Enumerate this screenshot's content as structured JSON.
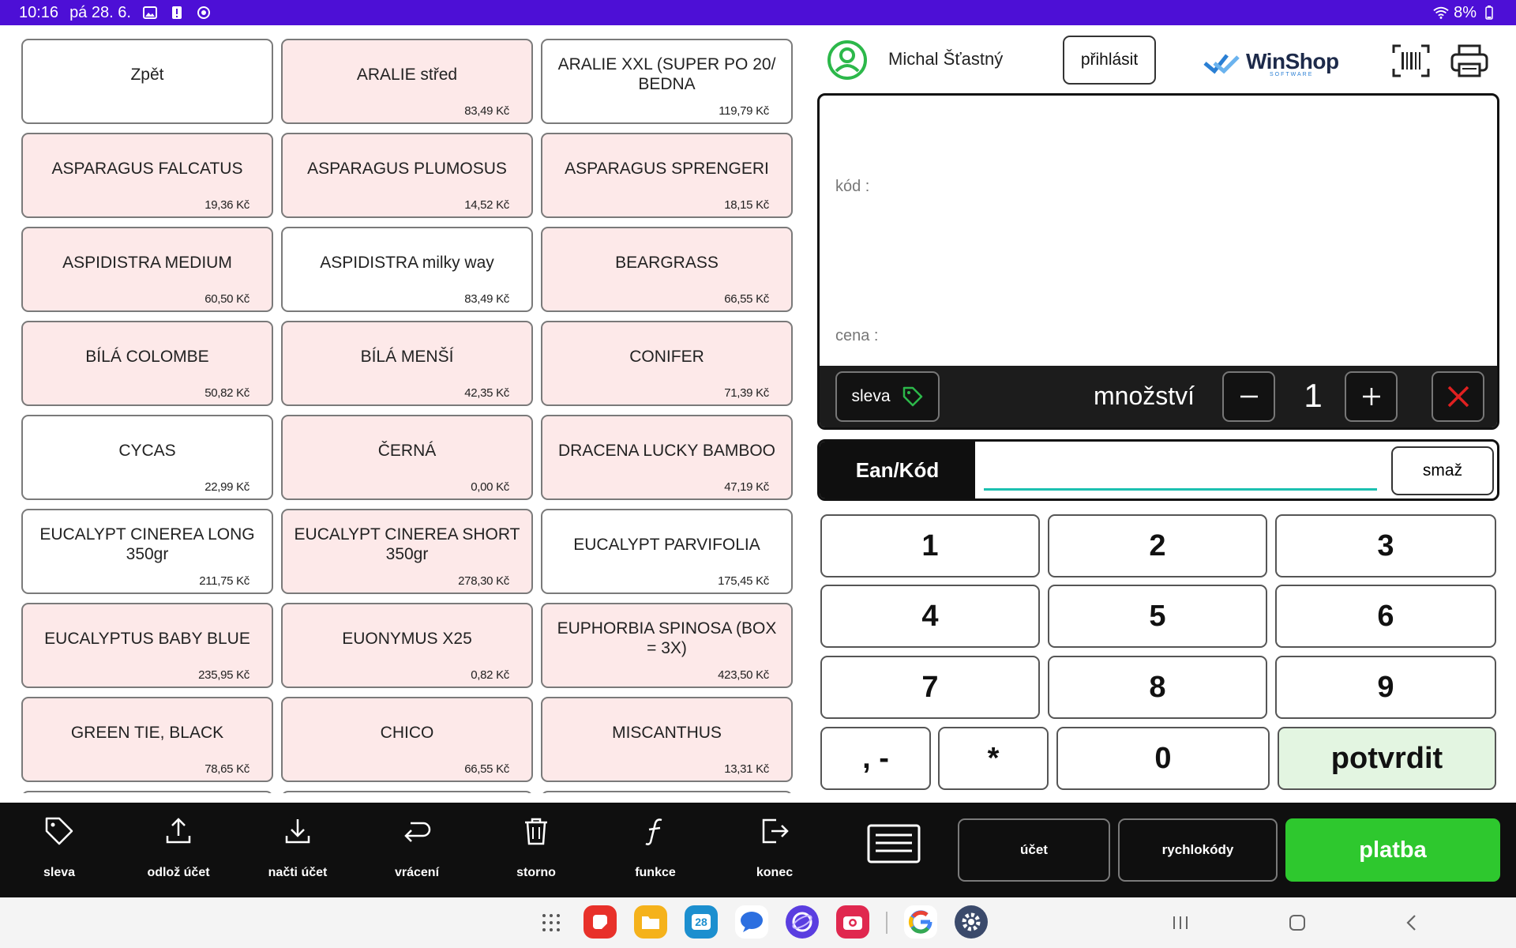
{
  "status_bar": {
    "time": "10:16",
    "date": "pá 28. 6.",
    "battery": "8%"
  },
  "products": [
    {
      "name": "Zpět",
      "price": "",
      "highlight": false
    },
    {
      "name": "ARALIE střed",
      "price": "83,49 Kč",
      "highlight": true
    },
    {
      "name": "ARALIE XXL (SUPER PO 20/ BEDNA",
      "price": "119,79 Kč",
      "highlight": false
    },
    {
      "name": "ASPARAGUS FALCATUS",
      "price": "19,36 Kč",
      "highlight": true
    },
    {
      "name": "ASPARAGUS PLUMOSUS",
      "price": "14,52 Kč",
      "highlight": true
    },
    {
      "name": "ASPARAGUS SPRENGERI",
      "price": "18,15 Kč",
      "highlight": true
    },
    {
      "name": "ASPIDISTRA MEDIUM",
      "price": "60,50 Kč",
      "highlight": true
    },
    {
      "name": "ASPIDISTRA milky way",
      "price": "83,49 Kč",
      "highlight": false
    },
    {
      "name": "BEARGRASS",
      "price": "66,55 Kč",
      "highlight": true
    },
    {
      "name": "BÍLÁ COLOMBE",
      "price": "50,82 Kč",
      "highlight": true
    },
    {
      "name": "BÍLÁ MENŠÍ",
      "price": "42,35 Kč",
      "highlight": true
    },
    {
      "name": "CONIFER",
      "price": "71,39 Kč",
      "highlight": true
    },
    {
      "name": "CYCAS",
      "price": "22,99 Kč",
      "highlight": false
    },
    {
      "name": "ČERNÁ",
      "price": "0,00 Kč",
      "highlight": true
    },
    {
      "name": "DRACENA LUCKY BAMBOO",
      "price": "47,19 Kč",
      "highlight": true
    },
    {
      "name": "EUCALYPT CINEREA LONG 350gr",
      "price": "211,75 Kč",
      "highlight": false
    },
    {
      "name": "EUCALYPT CINEREA SHORT 350gr",
      "price": "278,30 Kč",
      "highlight": true
    },
    {
      "name": "EUCALYPT PARVIFOLIA",
      "price": "175,45 Kč",
      "highlight": false
    },
    {
      "name": "EUCALYPTUS BABY BLUE",
      "price": "235,95 Kč",
      "highlight": true
    },
    {
      "name": "EUONYMUS X25",
      "price": "0,82 Kč",
      "highlight": true
    },
    {
      "name": "EUPHORBIA SPINOSA (BOX = 3X)",
      "price": "423,50 Kč",
      "highlight": true
    },
    {
      "name": "GREEN TIE, BLACK",
      "price": "78,65 Kč",
      "highlight": true
    },
    {
      "name": "CHICO",
      "price": "66,55 Kč",
      "highlight": true
    },
    {
      "name": "MISCANTHUS",
      "price": "13,31 Kč",
      "highlight": true
    }
  ],
  "header": {
    "user_name": "Michal Šťastný",
    "login_label": "přihlásit",
    "logo_text": "WinShop",
    "logo_subtext": "SOFTWARE"
  },
  "item": {
    "code_label": "kód :",
    "price_label": "cena :",
    "discount_label": "sleva",
    "quantity_label": "množství",
    "quantity_value": "1"
  },
  "ean": {
    "label": "Ean/Kód",
    "value": "",
    "clear_label": "smaž"
  },
  "keypad": {
    "keys": [
      "1",
      "2",
      "3",
      "4",
      "5",
      "6",
      "7",
      "8",
      "9"
    ],
    "comma_minus": ", -",
    "asterisk": "*",
    "zero": "0",
    "confirm": "potvrdit"
  },
  "toolbar": {
    "items": [
      {
        "label": "sleva",
        "icon": "tag-icon"
      },
      {
        "label": "odlož účet",
        "icon": "upload-icon"
      },
      {
        "label": "načti účet",
        "icon": "download-icon"
      },
      {
        "label": "vrácení",
        "icon": "return-icon"
      },
      {
        "label": "storno",
        "icon": "trash-icon"
      },
      {
        "label": "funkce",
        "icon": "function-icon"
      },
      {
        "label": "konec",
        "icon": "exit-icon"
      }
    ],
    "account_label": "účet",
    "quickcodes_label": "rychlokódy",
    "pay_label": "platba"
  },
  "nav": {
    "calendar_day": "28"
  },
  "colors": {
    "status_bar": "#4d0fd6",
    "product_highlight": "#fde9e9",
    "pay_button": "#2ec82e",
    "confirm_key": "#e3f5e1",
    "ean_underline": "#1cc0b0",
    "close_red": "#e02020",
    "user_icon_green": "#2cb84a"
  }
}
